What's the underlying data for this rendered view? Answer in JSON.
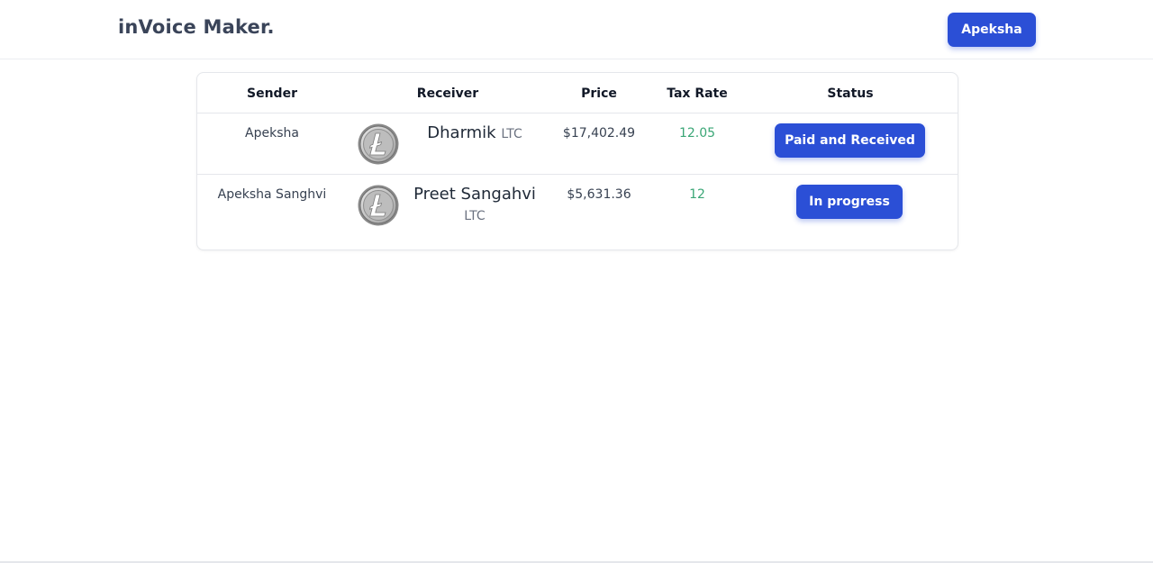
{
  "header": {
    "brand": "inVoice Maker.",
    "user_button": "Apeksha"
  },
  "table": {
    "columns": [
      "Sender",
      "Receiver",
      "Price",
      "Tax Rate",
      "Status"
    ],
    "rows": [
      {
        "sender": "Apeksha",
        "receiver_icon": "litecoin-icon",
        "receiver_name": "Dharmik",
        "receiver_ticker": "LTC",
        "price": "$17,402.49",
        "tax_rate": "12.05",
        "status": "Paid and Received"
      },
      {
        "sender": "Apeksha Sanghvi",
        "receiver_icon": "litecoin-icon",
        "receiver_name": "Preet Sangahvi",
        "receiver_ticker": "LTC",
        "price": "$5,631.36",
        "tax_rate": "12",
        "status": "In progress"
      }
    ]
  },
  "colors": {
    "accent": "#2b4fd6",
    "tax_text": "#3aa676",
    "brand_text": "#3a4459"
  }
}
